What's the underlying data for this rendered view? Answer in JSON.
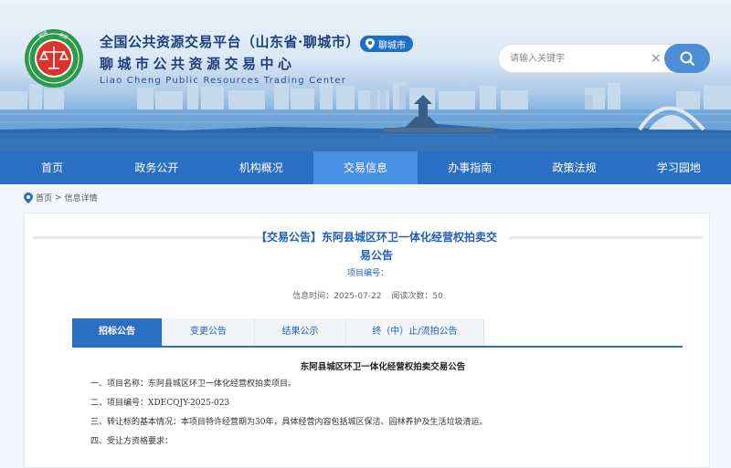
{
  "header": {
    "title_line1": "全国公共资源交易平台（山东省·聊城市）",
    "title_line2": "聊城市公共资源交易中心",
    "title_en": "Liao Cheng Public Resources Trading Center",
    "city": "聊城市",
    "logo_text": "聊城市公共资源交易中心"
  },
  "search": {
    "placeholder": "请输入关键字",
    "clear": "×"
  },
  "nav": {
    "items": [
      "首页",
      "政务公开",
      "机构概况",
      "交易信息",
      "办事指南",
      "政策法规",
      "学习园地"
    ],
    "active_index": 3
  },
  "breadcrumb": {
    "home": "首页",
    "sep": " > ",
    "current": "信息详情"
  },
  "article": {
    "title": "【交易公告】东阿县城区环卫一体化经营权拍卖交易公告",
    "project_no_label": "项目编号：",
    "publish_time": "信息时间：2025-07-22",
    "views": "阅读次数：50"
  },
  "tabs": {
    "items": [
      "招标公告",
      "变更公告",
      "结果公示",
      "终（中）止/流拍公告"
    ],
    "active_index": 0
  },
  "body": {
    "title": "东阿县城区环卫一体化经营权拍卖交易公告",
    "paragraphs": [
      "一、项目名称：东阿县城区环卫一体化经营权拍卖项目。",
      "二、项目编号：XDECQJY-2025-023",
      "三、转让标的基本情况：本项目特许经营期为30年，具体经营内容包括城区保洁、园林养护及生活垃圾清运。",
      "四、受让方资格要求："
    ]
  },
  "colors": {
    "nav_bg": "#2b6fc4",
    "nav_active": "#4a90e2",
    "title_blue": "#1f5fb8",
    "header_text": "#1f3f7a"
  }
}
